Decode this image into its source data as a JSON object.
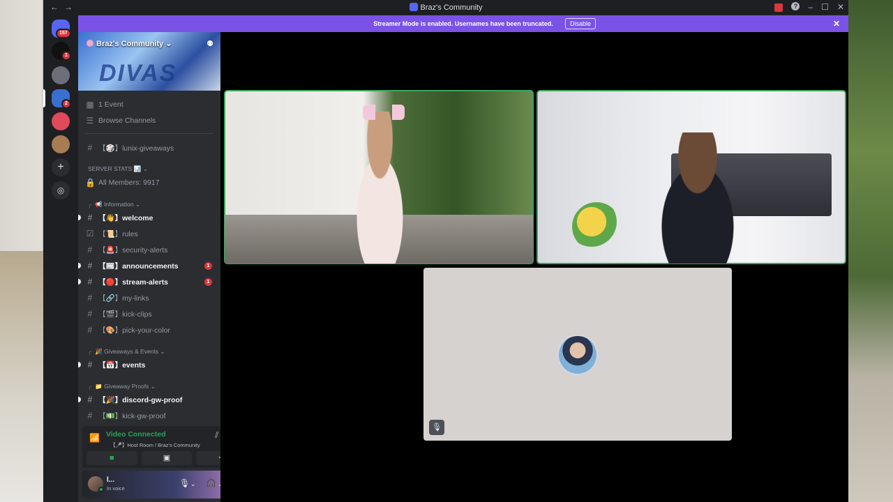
{
  "window": {
    "title": "Braz's Community"
  },
  "rail": {
    "home_badge": "157",
    "server2_badge": "1",
    "server4_badge": "2"
  },
  "banner": {
    "message": "Streamer Mode is enabled. Usernames have been truncated.",
    "disable_label": "Disable"
  },
  "server": {
    "name": "Braz's Community"
  },
  "sidebar": {
    "events": "1 Event",
    "browse": "Browse Channels",
    "channels": [
      {
        "label": "【🎲】lunix-giveaways",
        "unread": false
      },
      {
        "label": "All Members: 9917",
        "unread": false
      },
      {
        "label": "【👋】welcome",
        "unread": true
      },
      {
        "label": "【📜】rules",
        "unread": false
      },
      {
        "label": "【🚨】security-alerts",
        "unread": false
      },
      {
        "label": "【📰】announcements",
        "unread": true,
        "mentions": "1"
      },
      {
        "label": "【🔴】stream-alerts",
        "unread": true,
        "mentions": "1"
      },
      {
        "label": "【🔗】my-links",
        "unread": false
      },
      {
        "label": "【🎬】kick-clips",
        "unread": false
      },
      {
        "label": "【🎨】pick-your-color",
        "unread": false
      },
      {
        "label": "【📅】events",
        "unread": true
      },
      {
        "label": "【🎉】discord-gw-proof",
        "unread": true
      },
      {
        "label": "【💵】kick-gw-proof",
        "unread": false
      }
    ],
    "categories": [
      "SERVER STATS 📊",
      "📢 Information",
      "🎉 Giveaways & Events",
      "📁 Giveaway Proofs"
    ]
  },
  "voice": {
    "status": "Video Connected",
    "location": "【🎤】Host Room / Braz's Community"
  },
  "user": {
    "name": "l...",
    "status": "In voice"
  },
  "colors": {
    "accent": "#7b52e6",
    "speaking": "#3ba55d",
    "danger": "#da373c"
  }
}
